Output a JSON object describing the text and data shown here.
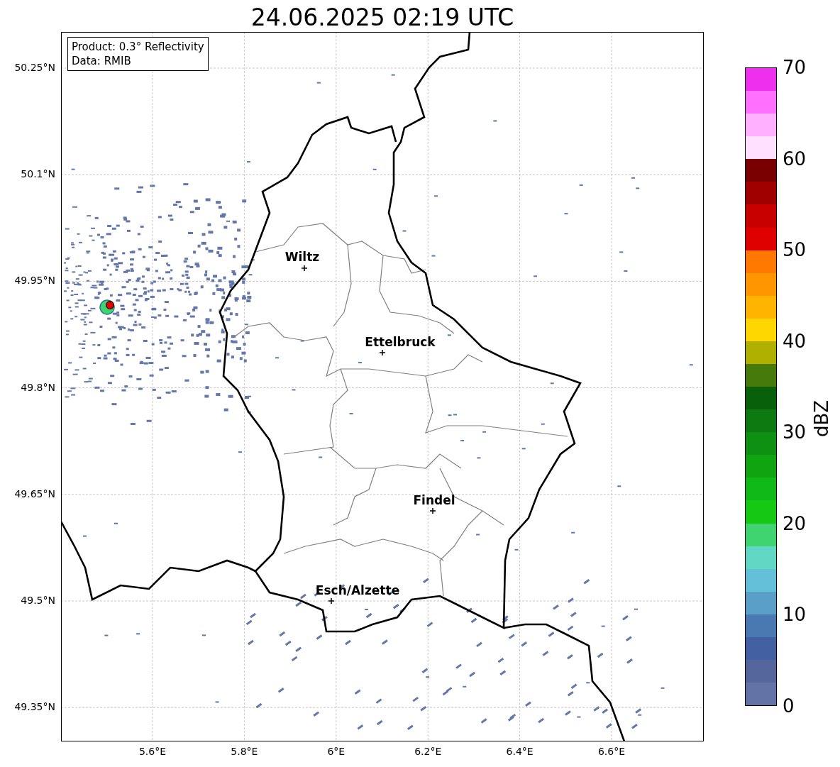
{
  "title": "24.06.2025 02:19 UTC",
  "info_box": [
    "Product: 0.3° Reflectivity",
    "Data: RMIB"
  ],
  "cities": [
    {
      "name": "Wiltz"
    },
    {
      "name": "Ettelbruck"
    },
    {
      "name": "Findel"
    },
    {
      "name": "Esch/Alzette"
    }
  ],
  "lat_ticks": [
    "50.25°N",
    "50.1°N",
    "49.95°N",
    "49.8°N",
    "49.65°N",
    "49.5°N",
    "49.35°N"
  ],
  "lon_ticks": [
    "5.6°E",
    "5.8°E",
    "6°E",
    "6.2°E",
    "6.4°E",
    "6.6°E"
  ],
  "colorbar": {
    "label": "dBZ",
    "ticks": [
      "70",
      "60",
      "50",
      "40",
      "30",
      "20",
      "10",
      "0"
    ],
    "bands": [
      {
        "color": "#6473a6"
      },
      {
        "color": "#55669c"
      },
      {
        "color": "#4360a2"
      },
      {
        "color": "#4a78b0"
      },
      {
        "color": "#5a9fc8"
      },
      {
        "color": "#63c0d9"
      },
      {
        "color": "#60d8c4"
      },
      {
        "color": "#40d470"
      },
      {
        "color": "#14c814"
      },
      {
        "color": "#10b818"
      },
      {
        "color": "#10a410"
      },
      {
        "color": "#0e9012"
      },
      {
        "color": "#0c7a10"
      },
      {
        "color": "#08600a"
      },
      {
        "color": "#467a0a"
      },
      {
        "color": "#b0b000"
      },
      {
        "color": "#ffd700"
      },
      {
        "color": "#ffb400"
      },
      {
        "color": "#ff9600"
      },
      {
        "color": "#ff7800"
      },
      {
        "color": "#e00000"
      },
      {
        "color": "#c80000"
      },
      {
        "color": "#a00000"
      },
      {
        "color": "#780000"
      },
      {
        "color": "#ffe0ff"
      },
      {
        "color": "#ffb0ff"
      },
      {
        "color": "#ff70ff"
      },
      {
        "color": "#ee30ee"
      }
    ]
  }
}
